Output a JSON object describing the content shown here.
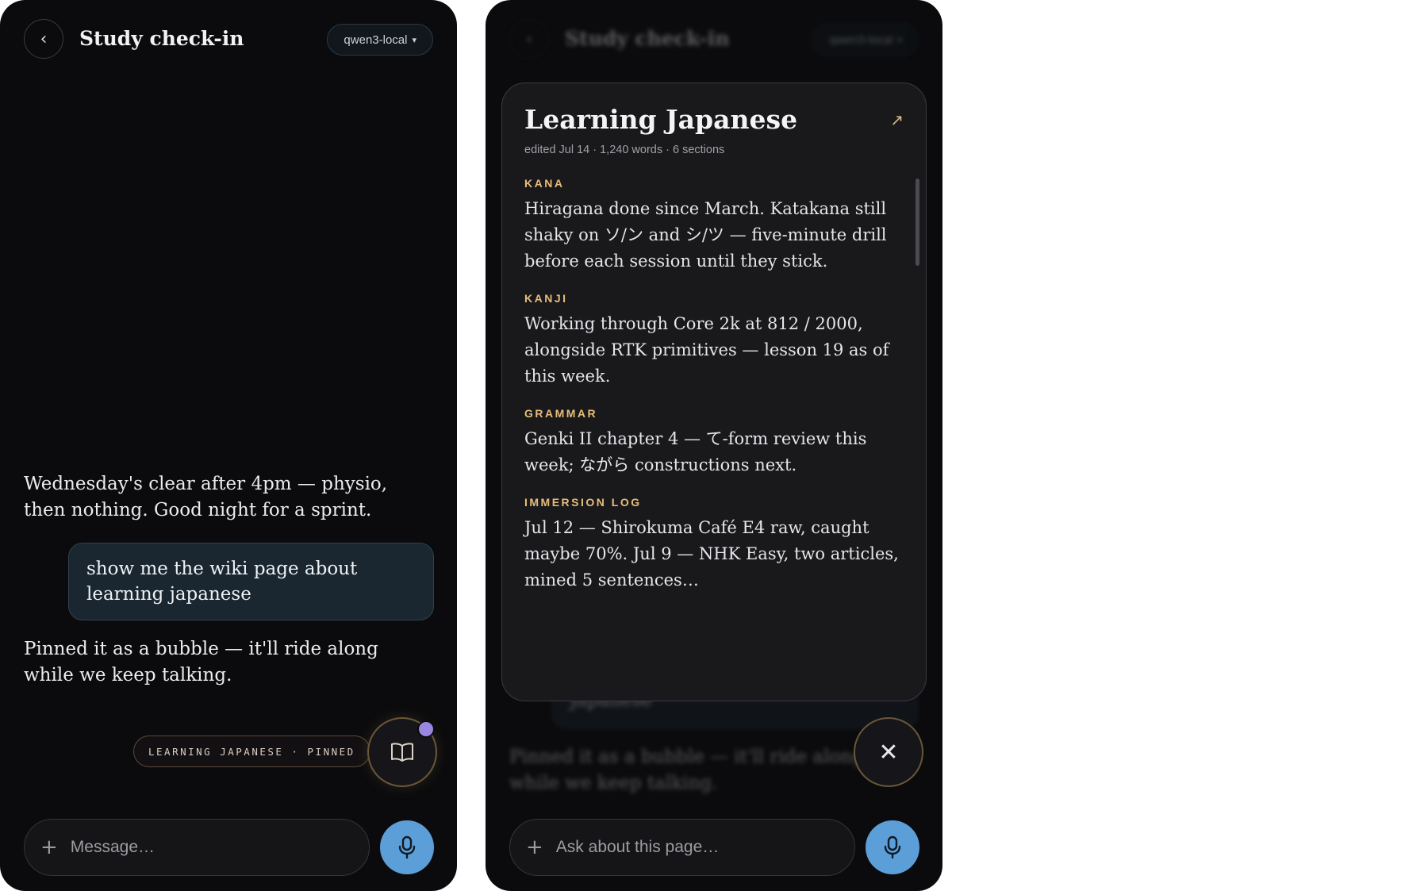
{
  "left": {
    "header": {
      "back_icon": "‹",
      "title": "Study check-in",
      "model": "qwen3-local"
    },
    "messages": {
      "assistant_1": "Wednesday's clear after 4pm — physio, then nothing. Good night for a sprint.",
      "user_1": "show me the wiki page about learning japanese",
      "assistant_2": "Pinned it as a bubble — it'll ride along while we keep talking."
    },
    "pinned_label": "LEARNING JAPANESE · PINNED",
    "composer": {
      "placeholder": "Message…"
    }
  },
  "right": {
    "header": {
      "back_icon": "‹",
      "title": "Study check-in",
      "model": "qwen3-local"
    },
    "background": {
      "user_1": "japanese",
      "assistant_2": "Pinned it as a bubble — it'll ride along while we keep talking."
    },
    "wiki": {
      "title": "Learning Japanese",
      "meta": "edited Jul 14 · 1,240 words · 6 sections",
      "sections": [
        {
          "label": "KANA",
          "body": "Hiragana done since March. Katakana still shaky on ソ/ン and シ/ツ — five-minute drill before each session until they stick."
        },
        {
          "label": "KANJI",
          "body": "Working through Core 2k at 812 / 2000, alongside RTK primitives — lesson 19 as of this week."
        },
        {
          "label": "GRAMMAR",
          "body": "Genki II chapter 4 — て-form review this week; ながら constructions next."
        },
        {
          "label": "IMMERSION LOG",
          "body": "Jul 12 — Shirokuma Café E4 raw, caught maybe 70%. Jul 9 — NHK Easy, two articles, mined 5 sentences…"
        }
      ]
    },
    "composer": {
      "placeholder": "Ask about this page…"
    }
  },
  "colors": {
    "accent": "#5c9fd8",
    "section_label": "#e7bd7a",
    "badge_dot": "#9a86e0"
  }
}
